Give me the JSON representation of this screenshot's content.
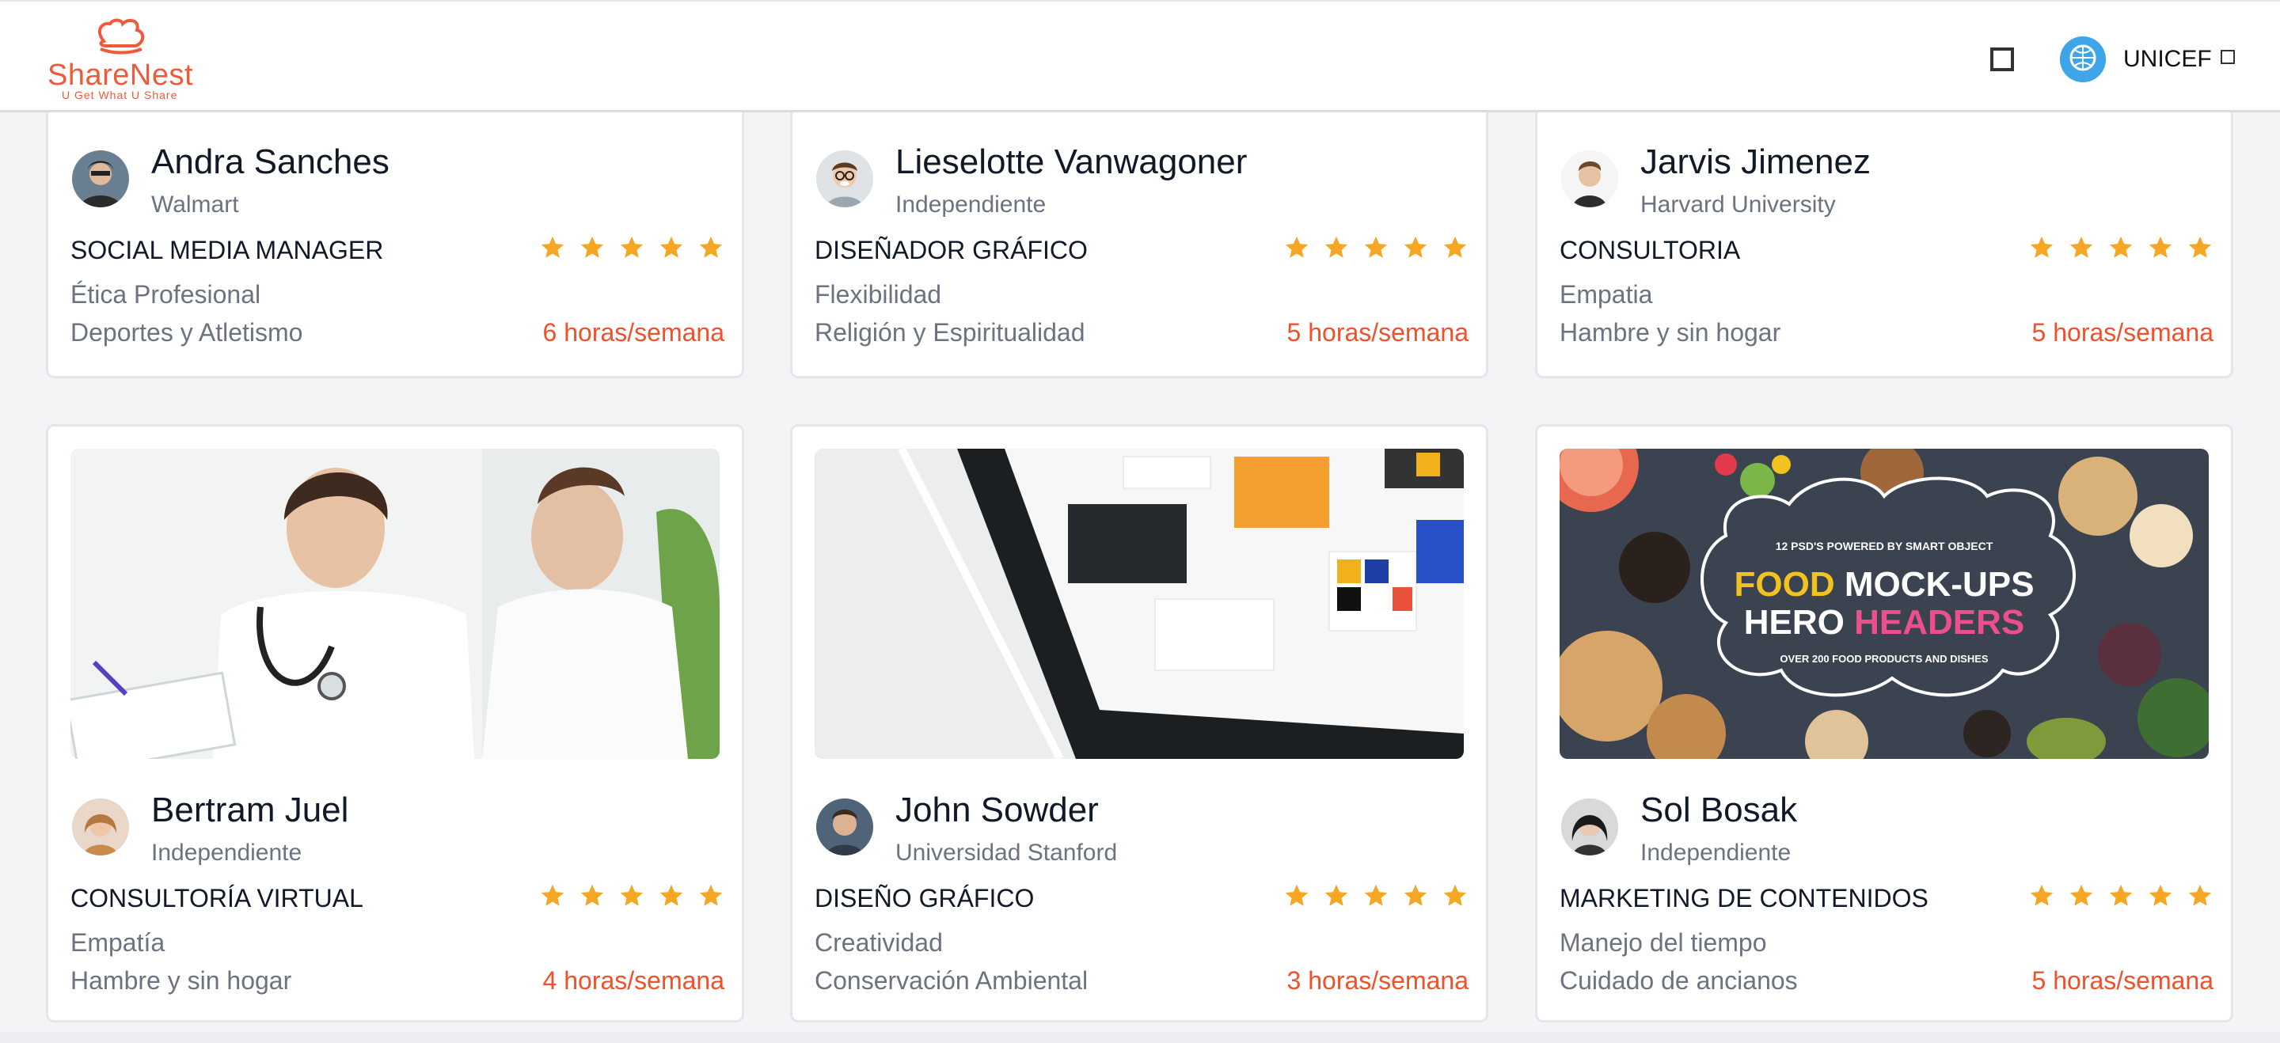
{
  "header": {
    "logo": {
      "name": "ShareNest",
      "tagline": "U Get What U Share"
    },
    "org": {
      "name": "UNICEF"
    },
    "colors": {
      "brand": "#f05a3a",
      "accent_hours": "#f0502a",
      "stars": "#f5a623"
    }
  },
  "cards": [
    {
      "name": "Andra Sanches",
      "org": "Walmart",
      "role": "SOCIAL MEDIA MANAGER",
      "rating": 5,
      "skill": "Ética Profesional",
      "cause": "Deportes y Atletismo",
      "hours": "6 horas/semana"
    },
    {
      "name": "Lieselotte Vanwagoner",
      "org": "Independiente",
      "role": "DISEÑADOR GRÁFICO",
      "rating": 5,
      "skill": "Flexibilidad",
      "cause": "Religión y Espiritualidad",
      "hours": "5 horas/semana"
    },
    {
      "name": "Jarvis Jimenez",
      "org": "Harvard University",
      "role": "CONSULTORIA",
      "rating": 5,
      "skill": "Empatia",
      "cause": "Hambre y sin hogar",
      "hours": "5 horas/semana"
    },
    {
      "name": "Bertram Juel",
      "org": "Independiente",
      "role": "CONSULTORÍA VIRTUAL",
      "rating": 5,
      "skill": "Empatía",
      "cause": "Hambre y sin hogar",
      "hours": "4 horas/semana"
    },
    {
      "name": "John Sowder",
      "org": "Universidad Stanford",
      "role": "DISEÑO GRÁFICO",
      "rating": 5,
      "skill": "Creatividad",
      "cause": "Conservación Ambiental",
      "hours": "3 horas/semana"
    },
    {
      "name": "Sol Bosak",
      "org": "Independiente",
      "role": "MARKETING DE CONTENIDOS",
      "rating": 5,
      "skill": "Manejo del tiempo",
      "cause": "Cuidado de ancianos",
      "hours": "5 horas/semana"
    }
  ],
  "food_banner": {
    "top": "12 PSD'S POWERED BY SMART OBJECT",
    "line1a": "FOOD",
    "line1b": "MOCK-UPS",
    "line2a": "HERO",
    "line2b": "HEADERS",
    "bottom": "OVER 200 FOOD PRODUCTS AND DISHES"
  }
}
